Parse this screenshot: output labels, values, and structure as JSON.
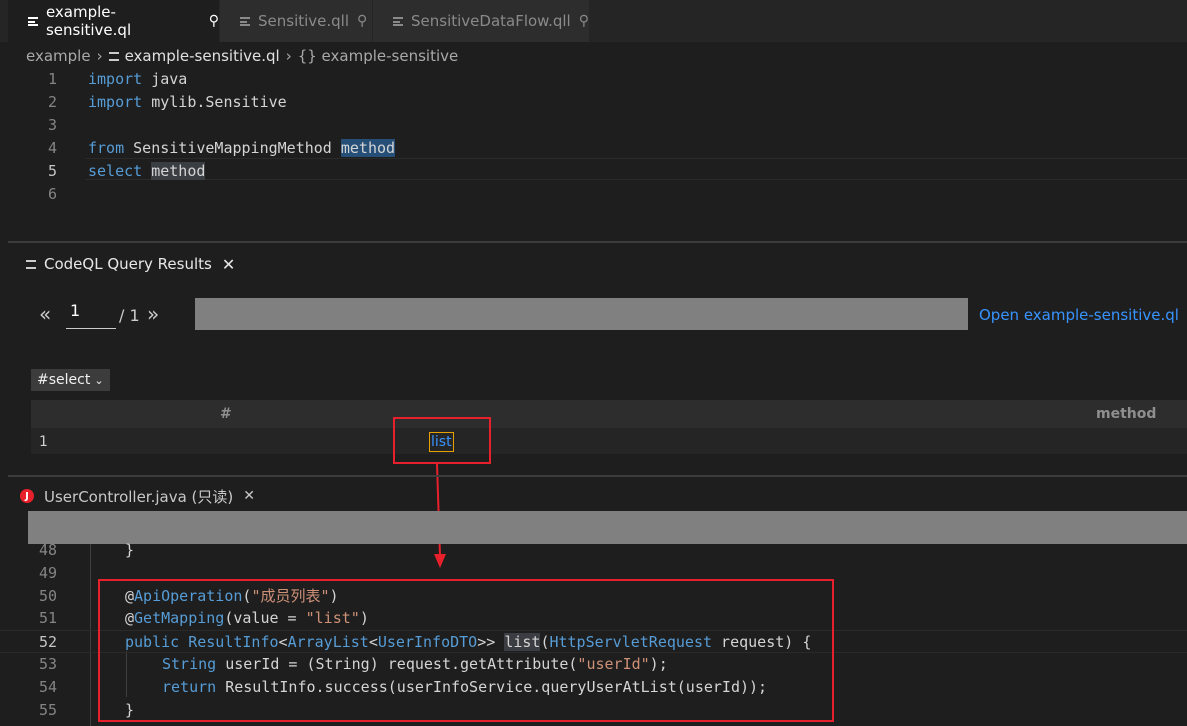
{
  "tabs": [
    {
      "label": "example-sensitive.ql",
      "active": true
    },
    {
      "label": "Sensitive.qll",
      "active": false
    },
    {
      "label": "SensitiveDataFlow.qll",
      "active": false
    }
  ],
  "breadcrumb": {
    "folder": "example",
    "file": "example-sensitive.ql",
    "symbol": "{} example-sensitive"
  },
  "editor": {
    "lines": [
      {
        "n": "1",
        "kw": "import",
        "rest": " java"
      },
      {
        "n": "2",
        "kw": "import",
        "rest": " mylib.Sensitive"
      },
      {
        "n": "3",
        "kw": "",
        "rest": ""
      },
      {
        "n": "4",
        "kw": "from",
        "rest": " SensitiveMappingMethod ",
        "var": "method"
      },
      {
        "n": "5",
        "kw": "select",
        "rest": " ",
        "var": "method"
      },
      {
        "n": "6",
        "kw": "",
        "rest": ""
      }
    ]
  },
  "results": {
    "panel_title": "CodeQL Query Results",
    "prev": "«",
    "next": "»",
    "page": "1",
    "total": "/ 1",
    "open_link": "Open example-sensitive.ql",
    "select_label": "#select",
    "columns": [
      "#",
      "method"
    ],
    "rows": [
      {
        "index": "1",
        "method": "list"
      }
    ]
  },
  "java": {
    "tab_label": "UserController.java (只读)",
    "line_numbers": [
      "48",
      "49",
      "50",
      "51",
      "52",
      "53",
      "54",
      "55"
    ],
    "l48": "}",
    "l50": {
      "at": "@",
      "name": "ApiOperation",
      "open": "(",
      "str": "\"成员列表\"",
      "close": ")"
    },
    "l51": {
      "at": "@",
      "name": "GetMapping",
      "pre": "(value = ",
      "str": "\"list\"",
      "close": ")"
    },
    "l52": {
      "kw": "public",
      "t1": "ResultInfo",
      "t2": "ArrayList",
      "t3": "UserInfoDTO",
      "fn": "list",
      "t4": "HttpServletRequest",
      "tail": " request) {"
    },
    "l53": {
      "t": "String",
      "mid": " userId = (String) request.getAttribute(",
      "str": "\"userId\"",
      "end": ");"
    },
    "l54": {
      "kw": "return",
      "rest": " ResultInfo.success(userInfoService.queryUserAtList(userId));"
    },
    "l55": "}"
  },
  "colors": {
    "accent": "#3794ff",
    "highlight_red": "#e8202b"
  }
}
